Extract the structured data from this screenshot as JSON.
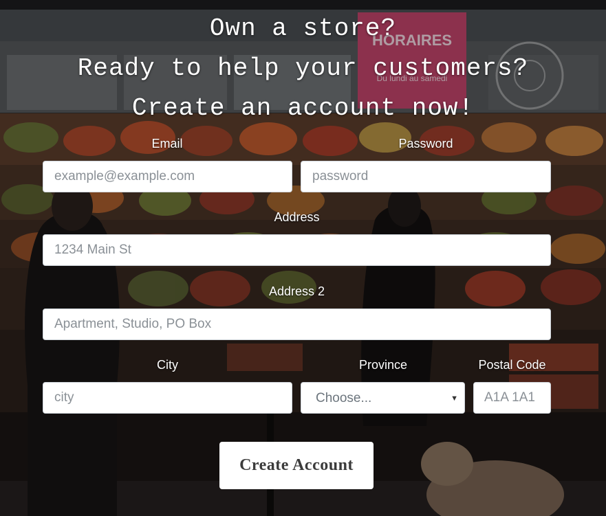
{
  "headline": {
    "line1": "Own a store?",
    "line2": "Ready to help your customers?",
    "line3": "Create an account now!"
  },
  "form": {
    "email": {
      "label": "Email",
      "placeholder": "example@example.com",
      "value": ""
    },
    "password": {
      "label": "Password",
      "placeholder": "password",
      "value": ""
    },
    "address": {
      "label": "Address",
      "placeholder": "1234 Main St",
      "value": ""
    },
    "address2": {
      "label": "Address 2",
      "placeholder": "Apartment, Studio, PO Box",
      "value": ""
    },
    "city": {
      "label": "City",
      "placeholder": "city",
      "value": ""
    },
    "province": {
      "label": "Province",
      "selected": "Choose..."
    },
    "postal_code": {
      "label": "Postal Code",
      "placeholder": "A1A 1A1",
      "value": ""
    },
    "submit_label": "Create Account"
  },
  "background": {
    "sign_text_1": "HORAIRES",
    "sign_text_2": "Du lundi au samedi",
    "sign_color": "#c2456b"
  },
  "icons": {
    "select_arrow": "chevron-down-icon"
  }
}
